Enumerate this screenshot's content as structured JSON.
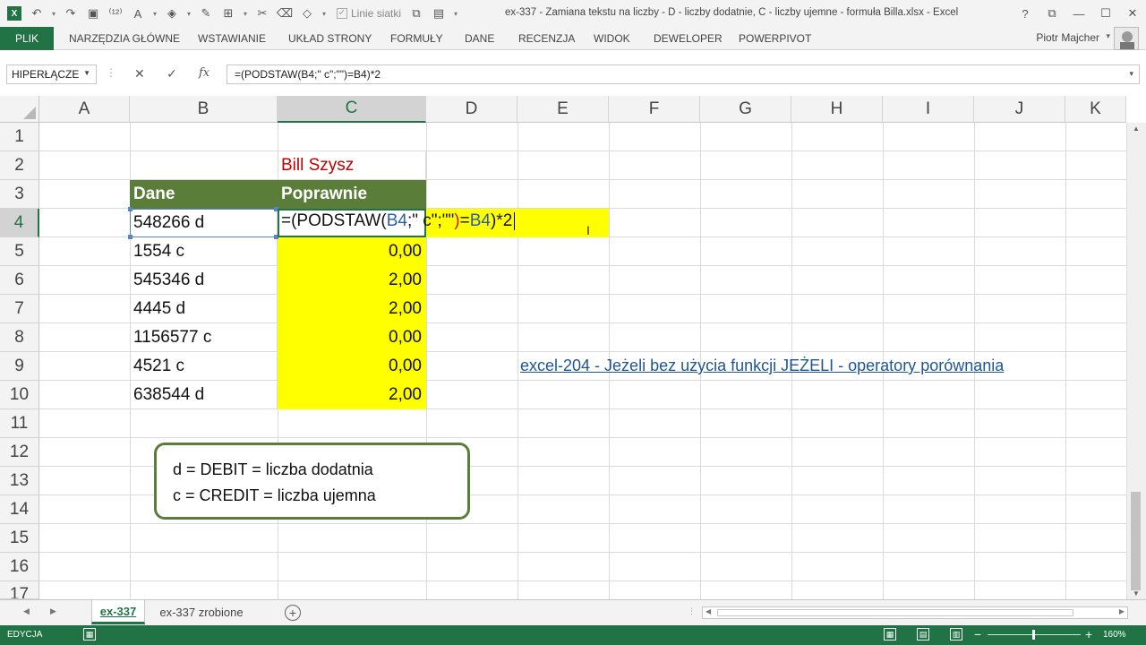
{
  "window": {
    "title": "ex-337 - Zamiana tekstu na liczby - D - liczby dodatnie, C - liczby ujemne - formuła Billa.xlsx - Excel",
    "help": "?",
    "restore": "⧉",
    "minimize": "—",
    "maximize": "☐",
    "close": "✕"
  },
  "qat": {
    "gridlines_label": "Linie siatki"
  },
  "ribbon": {
    "tabs": [
      "PLIK",
      "NARZĘDZIA GŁÓWNE",
      "WSTAWIANIE",
      "UKŁAD STRONY",
      "FORMUŁY",
      "DANE",
      "RECENZJA",
      "WIDOK",
      "DEWELOPER",
      "POWERPIVOT"
    ],
    "user": "Piotr Majcher"
  },
  "formula_bar": {
    "name_box": "HIPERŁĄCZE",
    "fx": "fx",
    "formula": "=(PODSTAW(B4;\" c\";\"\")=B4)*2"
  },
  "columns": [
    "A",
    "B",
    "C",
    "D",
    "E",
    "F",
    "G",
    "H",
    "I",
    "J",
    "K"
  ],
  "rows": [
    "1",
    "2",
    "3",
    "4",
    "5",
    "6",
    "7",
    "8",
    "9",
    "10",
    "11",
    "12",
    "13",
    "14",
    "15",
    "16",
    "17"
  ],
  "cells": {
    "C2": "Bill Szysz",
    "B3": "Dane",
    "C3": "Poprawnie",
    "B4": "548266 d",
    "B5": "1554 c",
    "B6": "545346 d",
    "B7": "4445 d",
    "B8": "1156577 c",
    "B9": "4521 c",
    "B10": "638544 d",
    "C5": "0,00",
    "C6": "2,00",
    "C7": "2,00",
    "C8": "0,00",
    "C9": "0,00",
    "C10": "2,00"
  },
  "edit": {
    "part1": "=(PODSTAW(",
    "ref1": "B4",
    "part2": ";\" c\";\"\"",
    "close1": ")",
    "part3": "=",
    "ref2": "B4",
    "part4": ")*2"
  },
  "link_text": "excel-204 - Jeżeli bez użycia funkcji JEŻELI - operatory porównania",
  "note": {
    "line1": "d = DEBIT = liczba dodatnia",
    "line2": "c = CREDIT = liczba ujemna"
  },
  "sheets": [
    "ex-337",
    "ex-337 zrobione"
  ],
  "status": {
    "mode": "EDYCJA",
    "zoom": "160%"
  },
  "colors": {
    "excel_green": "#217346",
    "header_fill": "#5b7d3a",
    "highlight": "#ffff00",
    "author_red": "#c00000",
    "link_blue": "#1f5691"
  }
}
